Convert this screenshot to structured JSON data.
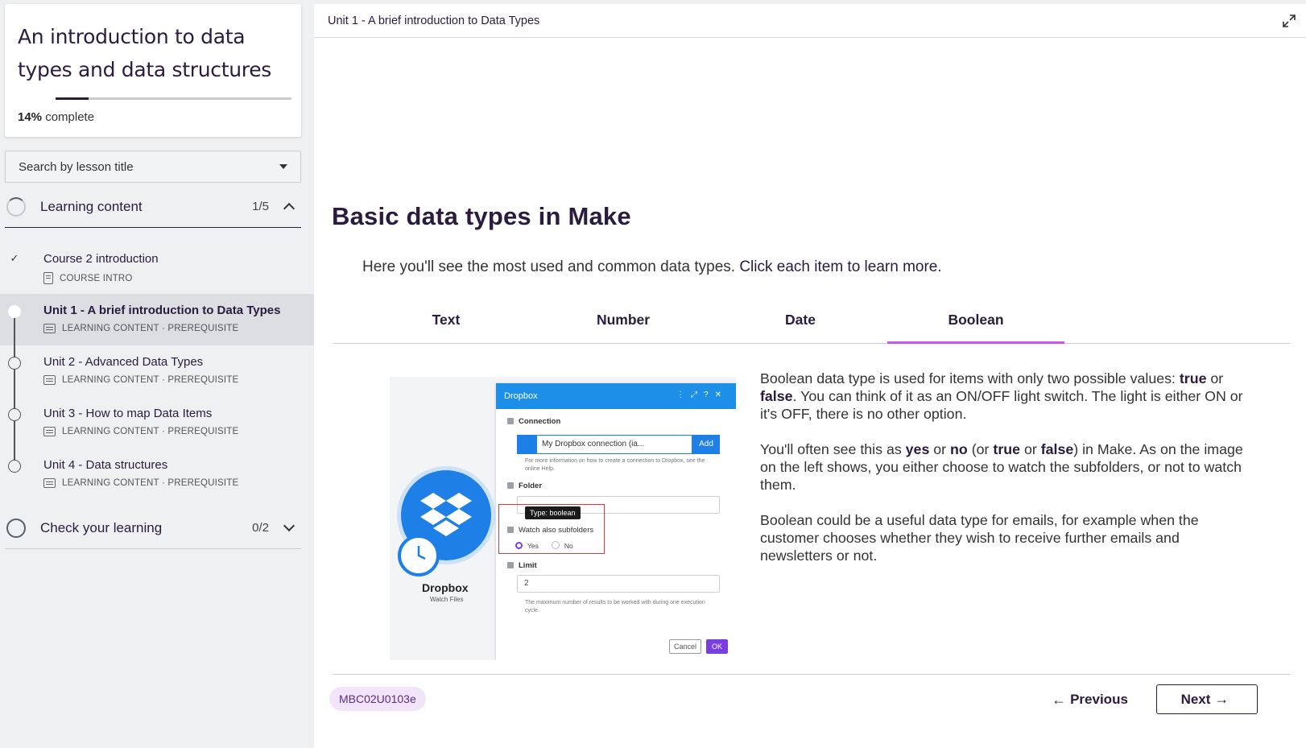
{
  "sidebar": {
    "course_title": "An introduction to data types and data structures",
    "progress_percent": "14%",
    "progress_label": "complete",
    "progress_fraction": 0.14,
    "search_placeholder": "Search by lesson title",
    "sections": [
      {
        "title": "Learning content",
        "count": "1/5",
        "expanded": true
      },
      {
        "title": "Check your learning",
        "count": "0/2",
        "expanded": false
      }
    ],
    "lessons": [
      {
        "name": "Course 2 introduction",
        "meta": "COURSE INTRO",
        "status": "done"
      },
      {
        "name": "Unit 1 - A brief introduction to Data Types",
        "meta": "LEARNING CONTENT · PREREQUISITE",
        "status": "active"
      },
      {
        "name": "Unit 2 - Advanced Data Types",
        "meta": "LEARNING CONTENT · PREREQUISITE",
        "status": "todo"
      },
      {
        "name": "Unit 3 - How to map Data Items",
        "meta": "LEARNING CONTENT · PREREQUISITE",
        "status": "todo"
      },
      {
        "name": "Unit 4 - Data structures",
        "meta": "LEARNING CONTENT · PREREQUISITE",
        "status": "todo"
      }
    ]
  },
  "main": {
    "topbar_title": "Unit 1 - A brief introduction to Data Types",
    "page_title": "Basic data types in Make",
    "intro_text": "Here you'll see the most used and common data types. ",
    "intro_bold": "Click each item to learn more",
    "intro_end": ".",
    "tabs": [
      {
        "label": "Text",
        "active": false
      },
      {
        "label": "Number",
        "active": false
      },
      {
        "label": "Date",
        "active": false
      },
      {
        "label": "Boolean",
        "active": true
      }
    ],
    "screenshot": {
      "header": "Dropbox",
      "connection_label": "Connection",
      "connection_value": "My Dropbox connection (ia...",
      "add_label": "Add",
      "connection_note": "For more information on how to create a connection to Dropbox, see the online Help.",
      "folder_label": "Folder",
      "tooltip": "Type: boolean",
      "watch_label": "Watch also subfolders",
      "yes_label": "Yes",
      "no_label": "No",
      "limit_label": "Limit",
      "limit_value": "2",
      "limit_note": "The maximum number of results to be worked with during one execution cycle.",
      "cancel_label": "Cancel",
      "ok_label": "OK",
      "app_name": "Dropbox",
      "app_sub": "Watch Files"
    },
    "desc": {
      "p1_a": "Boolean data type is used for items with only two possible values: ",
      "p1_true": "true",
      "p1_b": " or ",
      "p1_false": "false",
      "p1_c": ". You can think of it as an ON/OFF light switch. The light is either ON or it's OFF, there is no other option.",
      "p2_a": "You'll often see this as ",
      "p2_yes": "yes",
      "p2_b": " or ",
      "p2_no": "no",
      "p2_c": " (or ",
      "p2_true": "true",
      "p2_d": " or ",
      "p2_false": "false",
      "p2_e": ") in Make. As on the image on the left shows, you either choose to watch the subfolders, or not to watch them.",
      "p3": "Boolean could be a useful data type for emails, for example when the customer chooses whether they wish to receive further emails and newsletters or not."
    },
    "footer": {
      "code": "MBC02U0103e",
      "prev_label": "Previous",
      "next_label": "Next"
    }
  },
  "colors": {
    "brand_dark": "#2b1b3f",
    "tab_accent": "#c45ae6",
    "badge_bg": "#f1e4fb"
  }
}
